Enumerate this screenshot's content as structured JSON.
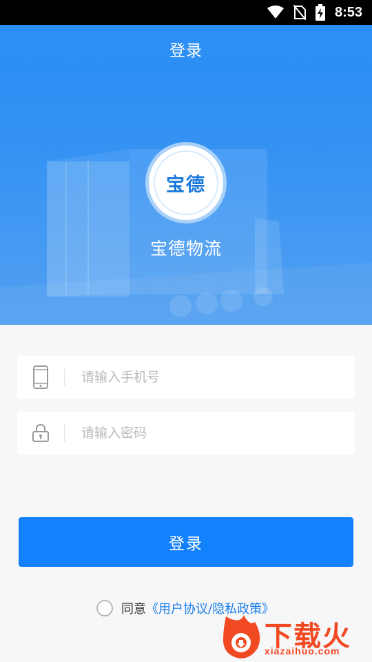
{
  "status_bar": {
    "time": "8:53",
    "icons": [
      "wifi-icon",
      "no-sim-icon",
      "battery-charging-icon"
    ]
  },
  "header": {
    "title": "登录"
  },
  "brand": {
    "logo_text": "宝德",
    "company_name": "宝德物流"
  },
  "form": {
    "phone": {
      "icon": "mobile-phone-icon",
      "placeholder": "请输入手机号",
      "value": ""
    },
    "password": {
      "icon": "lock-icon",
      "placeholder": "请输入密码",
      "value": ""
    },
    "login_label": "登录"
  },
  "agreement": {
    "checked": false,
    "prefix": "同意",
    "link": "《用户协议/隐私政策》"
  },
  "watermark": {
    "text": "下载火",
    "domain": "xiazaihuo.com"
  },
  "colors": {
    "primary": "#1381fb",
    "hero": "#2c8ff5",
    "link": "#1a7ee8",
    "watermark": "#f14a22"
  }
}
